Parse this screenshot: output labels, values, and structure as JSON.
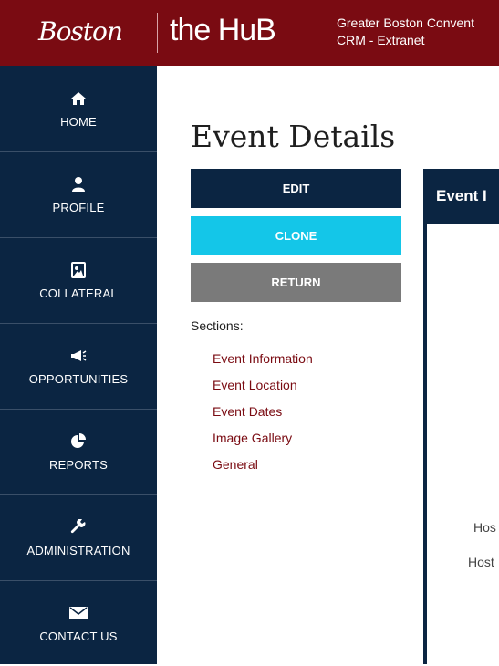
{
  "header": {
    "brand_left": "Boston",
    "brand_right": "the HuB",
    "subtitle_line1": "Greater Boston Convent",
    "subtitle_line2": "CRM - Extranet"
  },
  "sidebar": {
    "items": [
      {
        "label": "HOME",
        "icon": "home-icon"
      },
      {
        "label": "PROFILE",
        "icon": "user-icon"
      },
      {
        "label": "COLLATERAL",
        "icon": "image-icon"
      },
      {
        "label": "OPPORTUNITIES",
        "icon": "megaphone-icon"
      },
      {
        "label": "REPORTS",
        "icon": "pie-chart-icon"
      },
      {
        "label": "ADMINISTRATION",
        "icon": "wrench-icon"
      },
      {
        "label": "CONTACT US",
        "icon": "envelope-icon"
      }
    ]
  },
  "main": {
    "title": "Event Details",
    "buttons": {
      "edit": "EDIT",
      "clone": "CLONE",
      "return": "RETURN"
    },
    "sections_label": "Sections:",
    "sections": [
      "Event Information",
      "Event Location",
      "Event Dates",
      "Image Gallery",
      "General"
    ]
  },
  "panel": {
    "header": "Event I",
    "field1": "Hos",
    "field2": "Host"
  },
  "colors": {
    "header_bg": "#7a0b12",
    "sidebar_bg": "#0b2542",
    "clone_bg": "#14c6e8",
    "return_bg": "#7a7a7a",
    "link": "#7a0b12"
  }
}
